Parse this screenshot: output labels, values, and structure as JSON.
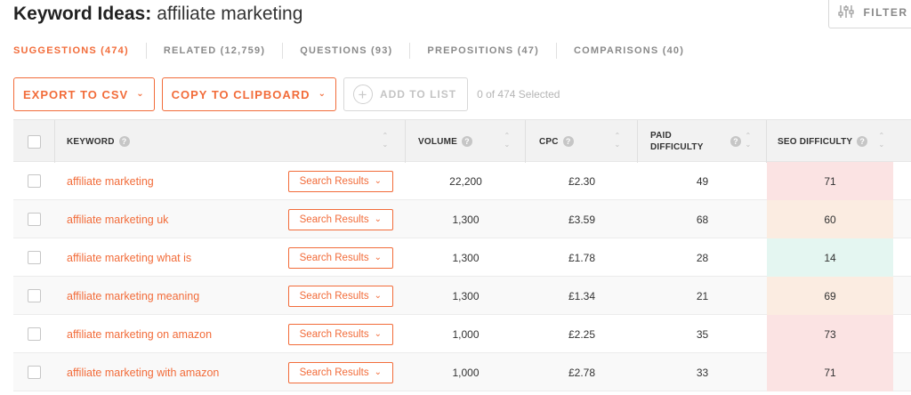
{
  "header": {
    "title_strong": "Keyword Ideas:",
    "title_rest": "affiliate marketing",
    "filter_label": "FILTER",
    "filter_icon": "sliders-icon"
  },
  "tabs": [
    {
      "label": "SUGGESTIONS (474)",
      "active": true
    },
    {
      "label": "RELATED (12,759)",
      "active": false
    },
    {
      "label": "QUESTIONS (93)",
      "active": false
    },
    {
      "label": "PREPOSITIONS (47)",
      "active": false
    },
    {
      "label": "COMPARISONS (40)",
      "active": false
    }
  ],
  "actions": {
    "export_label": "EXPORT TO CSV",
    "copy_label": "COPY TO CLIPBOARD",
    "add_label": "ADD TO LIST",
    "selected_text": "0 of 474 Selected"
  },
  "table": {
    "columns": {
      "keyword": "KEYWORD",
      "volume": "VOLUME",
      "cpc": "CPC",
      "paid_difficulty_line1": "PAID",
      "paid_difficulty_line2": "DIFFICULTY",
      "seo_difficulty": "SEO DIFFICULTY"
    },
    "search_results_label": "Search Results",
    "rows": [
      {
        "keyword": "affiliate marketing",
        "volume": "22,200",
        "cpc": "£2.30",
        "paid_difficulty": "49",
        "seo_difficulty": "71",
        "seo_color": "#fbe3e3"
      },
      {
        "keyword": "affiliate marketing uk",
        "volume": "1,300",
        "cpc": "£3.59",
        "paid_difficulty": "68",
        "seo_difficulty": "60",
        "seo_color": "#fbece1"
      },
      {
        "keyword": "affiliate marketing what is",
        "volume": "1,300",
        "cpc": "£1.78",
        "paid_difficulty": "28",
        "seo_difficulty": "14",
        "seo_color": "#e4f6f1"
      },
      {
        "keyword": "affiliate marketing meaning",
        "volume": "1,300",
        "cpc": "£1.34",
        "paid_difficulty": "21",
        "seo_difficulty": "69",
        "seo_color": "#fbece1"
      },
      {
        "keyword": "affiliate marketing on amazon",
        "volume": "1,000",
        "cpc": "£2.25",
        "paid_difficulty": "35",
        "seo_difficulty": "73",
        "seo_color": "#fbe3e3"
      },
      {
        "keyword": "affiliate marketing with amazon",
        "volume": "1,000",
        "cpc": "£2.78",
        "paid_difficulty": "33",
        "seo_difficulty": "71",
        "seo_color": "#fbe3e3"
      }
    ]
  },
  "colors": {
    "accent": "#f26c3a"
  }
}
